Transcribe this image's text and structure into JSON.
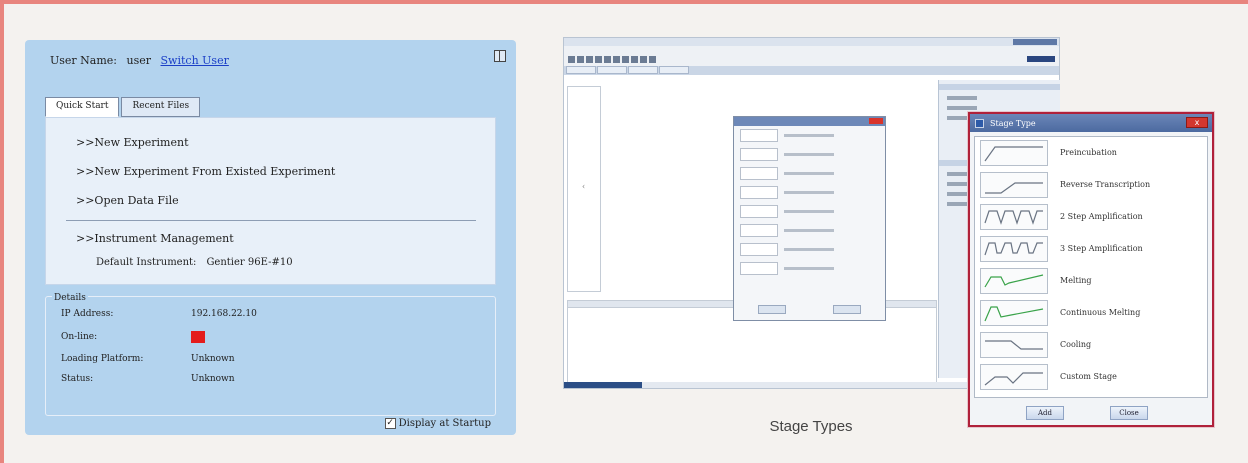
{
  "start_panel": {
    "user_label": "User Name:",
    "user_value": "user",
    "switch_user": "Switch User",
    "tabs": [
      "Quick Start",
      "Recent Files"
    ],
    "links": [
      ">>New Experiment",
      ">>New Experiment From Existed Experiment",
      ">>Open Data File",
      ">>Instrument Management"
    ],
    "default_instrument_label": "Default Instrument:",
    "default_instrument_value": "Gentier 96E-#10",
    "details_title": "Details",
    "details": [
      {
        "label": "IP Address:",
        "value": "192.168.22.10"
      },
      {
        "label": "On-line:",
        "value": ""
      },
      {
        "label": "Loading Platform:",
        "value": "Unknown"
      },
      {
        "label": "Status:",
        "value": "Unknown"
      }
    ],
    "online_color": "#e41c1c",
    "display_at_startup": "Display at Startup",
    "display_at_startup_checked": true
  },
  "caption": "Stage Types",
  "stage_dialog": {
    "title": "Stage Type",
    "close_glyph": "x",
    "items": [
      "Preincubation",
      "Reverse Transcription",
      "2 Step Amplification",
      "3 Step Amplification",
      "Melting",
      "Continuous Melting",
      "Cooling",
      "Custom Stage"
    ],
    "add_button": "Add",
    "close_button": "Close",
    "border_color": "#b0213a"
  }
}
